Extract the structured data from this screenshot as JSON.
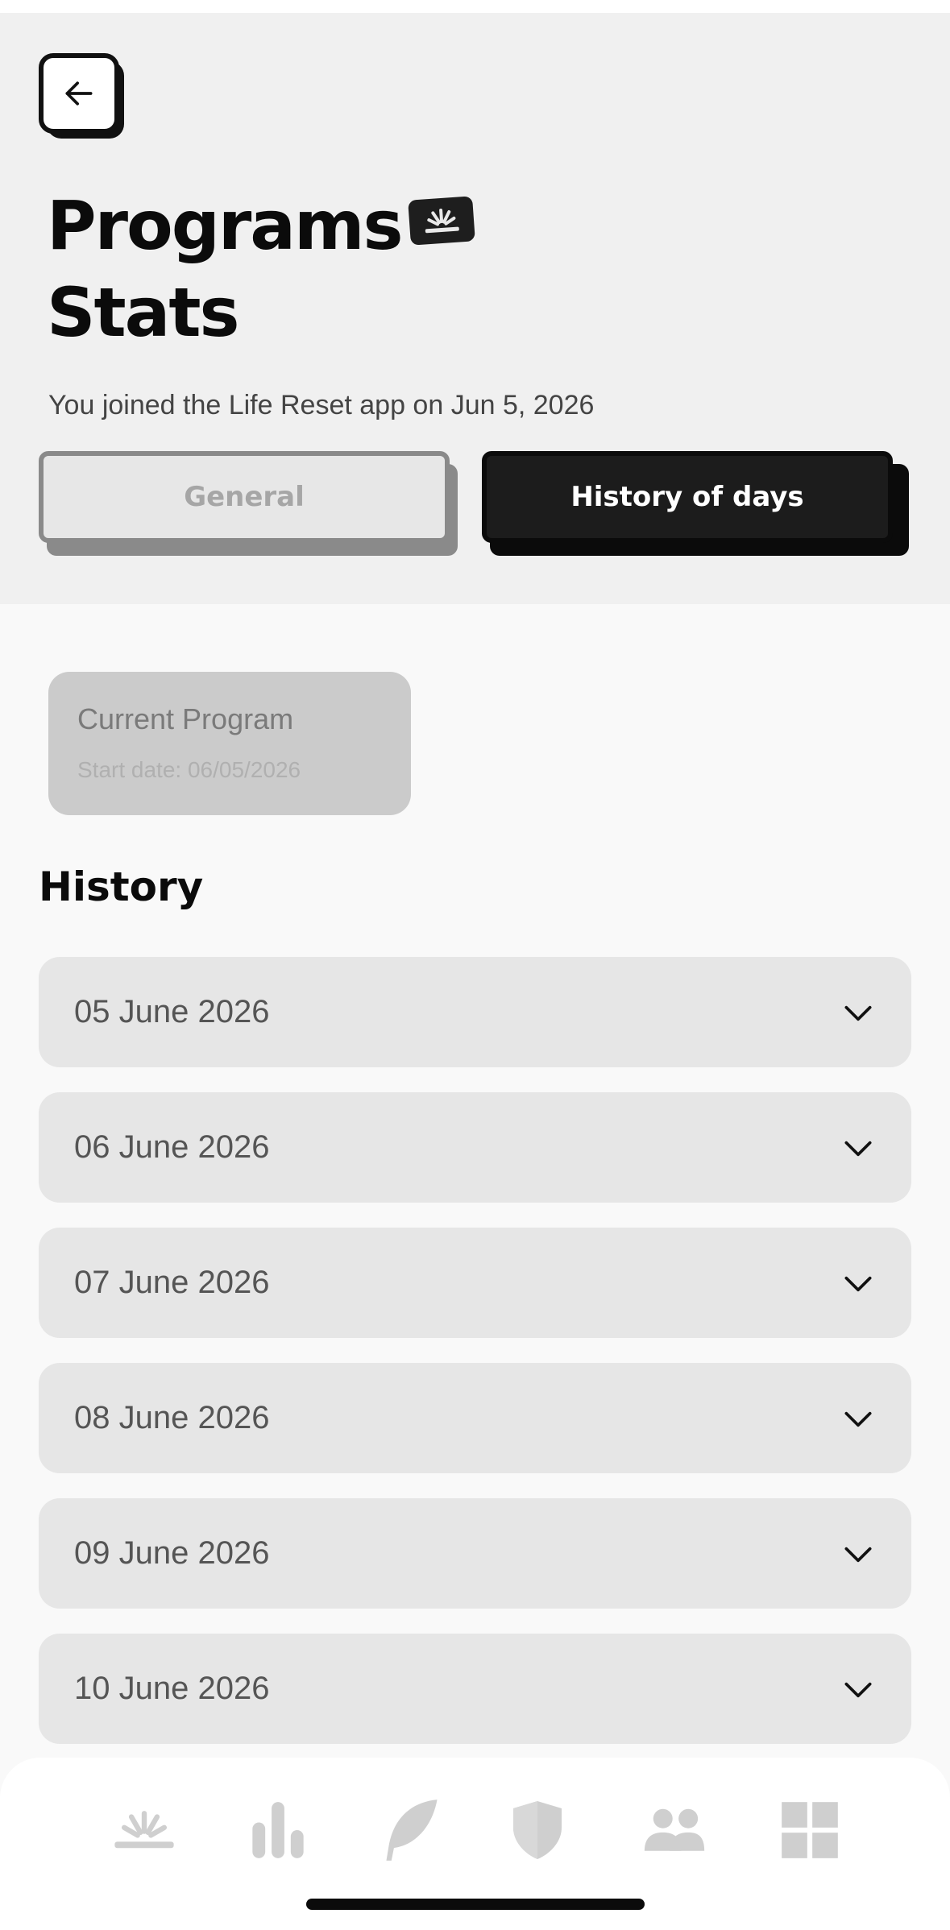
{
  "header": {
    "back_icon": "arrow-left-icon",
    "title_line1": "Programs",
    "title_line2": "Stats",
    "title_badge_icon": "sunrise-icon",
    "subtitle": "You joined the Life Reset app on Jun 5, 2026"
  },
  "tabs": [
    {
      "label": "General",
      "selected": false
    },
    {
      "label": "History of days",
      "selected": true
    }
  ],
  "current_program": {
    "title": "Current Program",
    "start_date": "Start date: 06/05/2026"
  },
  "history": {
    "heading": "History",
    "items": [
      {
        "date": "05 June 2026"
      },
      {
        "date": "06 June 2026"
      },
      {
        "date": "07 June 2026"
      },
      {
        "date": "08 June 2026"
      },
      {
        "date": "09 June 2026"
      },
      {
        "date": "10 June 2026"
      }
    ],
    "expand_icon": "chevron-down-icon"
  },
  "bottom_nav": [
    {
      "icon": "sunrise-icon"
    },
    {
      "icon": "bar-chart-icon"
    },
    {
      "icon": "feather-icon"
    },
    {
      "icon": "shield-icon"
    },
    {
      "icon": "users-icon"
    },
    {
      "icon": "grid-icon"
    }
  ],
  "colors": {
    "header_bg": "#f0f0f0",
    "page_bg": "#f9f9f9",
    "accent_dark": "#1c1c1c",
    "card_bg": "#e6e6e6",
    "nav_icon": "#cfcfcf"
  }
}
